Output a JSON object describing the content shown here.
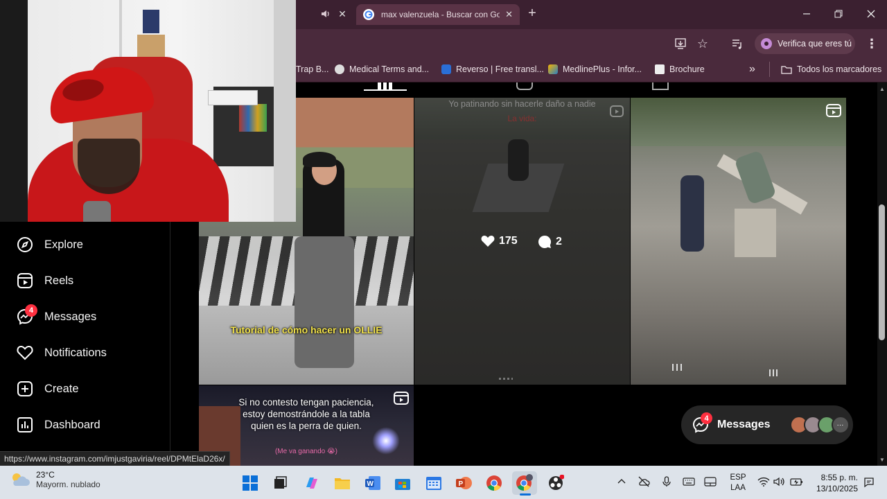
{
  "browser": {
    "tabs": [
      {
        "title": "max valenzuela - Buscar con Go",
        "active": true
      }
    ],
    "new_tab": "+",
    "profile_prompt": "Verifica que eres tú",
    "bookmarks": [
      {
        "label": "Trap B..."
      },
      {
        "label": "Medical Terms and..."
      },
      {
        "label": "Reverso | Free transl..."
      },
      {
        "label": "MedlinePlus - Infor..."
      },
      {
        "label": "Brochure"
      }
    ],
    "all_bookmarks": "Todos los marcadores",
    "overflow": "»",
    "status_url": "https://www.instagram.com/imjustgaviria/reel/DPMtElaD26x/"
  },
  "instagram": {
    "nav": [
      {
        "label": "Explore",
        "icon": "compass-icon"
      },
      {
        "label": "Reels",
        "icon": "reels-icon"
      },
      {
        "label": "Messages",
        "icon": "messenger-icon",
        "badge": "4"
      },
      {
        "label": "Notifications",
        "icon": "heart-icon"
      },
      {
        "label": "Create",
        "icon": "plus-square-icon"
      },
      {
        "label": "Dashboard",
        "icon": "chart-icon"
      }
    ],
    "posts": [
      {
        "caption": "Tutorial de cómo hacer un OLLIE"
      },
      {
        "caption_top": "Yo patinando sin hacerle daño a nadie",
        "caption_sub": "La vida:",
        "likes": "175",
        "comments": "2"
      },
      {
        "caption": ""
      },
      {
        "caption": "Si no contesto tengan paciencia, estoy demostrándole a la tabla quien es la perra de quien.",
        "caption_sub": "(Me va ganando 😭)"
      }
    ],
    "messages_bubble": {
      "label": "Messages",
      "badge": "4",
      "more": "···"
    }
  },
  "taskbar": {
    "weather_temp": "23°C",
    "weather_desc": "Mayorm. nublado",
    "lang_top": "ESP",
    "lang_bottom": "LAA",
    "time": "8:55 p. m.",
    "date": "13/10/2025"
  },
  "colors": {
    "tabstrip": "#3b2030",
    "toolbar": "#4a2a3c",
    "badge": "#ff3040",
    "caption_yellow": "#f2e24a"
  }
}
